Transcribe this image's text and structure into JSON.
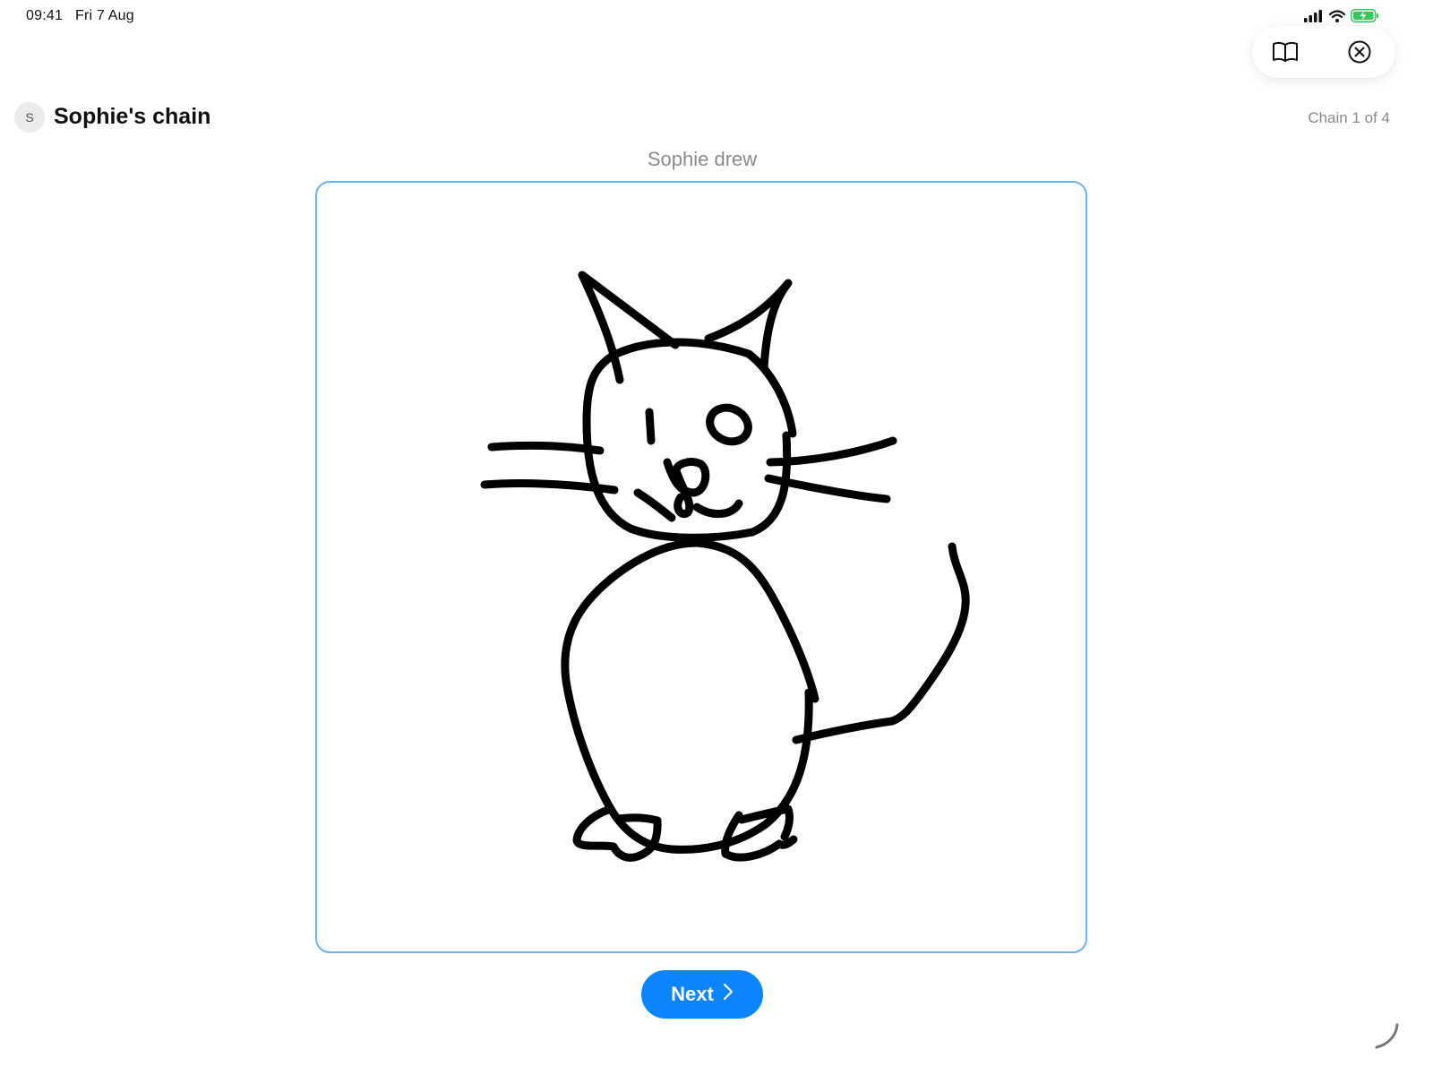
{
  "status_bar": {
    "time": "09:41",
    "date": "Fri 7 Aug",
    "icons": [
      "cellular-signal-icon",
      "wifi-icon",
      "battery-charging-icon"
    ],
    "battery_color": "#34c759"
  },
  "toolbar": {
    "icons": [
      "book-icon",
      "close-circle-icon"
    ]
  },
  "header": {
    "avatar_initial": "S",
    "title": "Sophie's chain",
    "counter": "Chain 1 of 4"
  },
  "caption": "Sophie drew",
  "drawing": {
    "subject": "cat-drawing",
    "stroke_color": "#000000",
    "frame_color": "#68b4f2"
  },
  "next_button": {
    "label": "Next",
    "color": "#0a84ff"
  }
}
